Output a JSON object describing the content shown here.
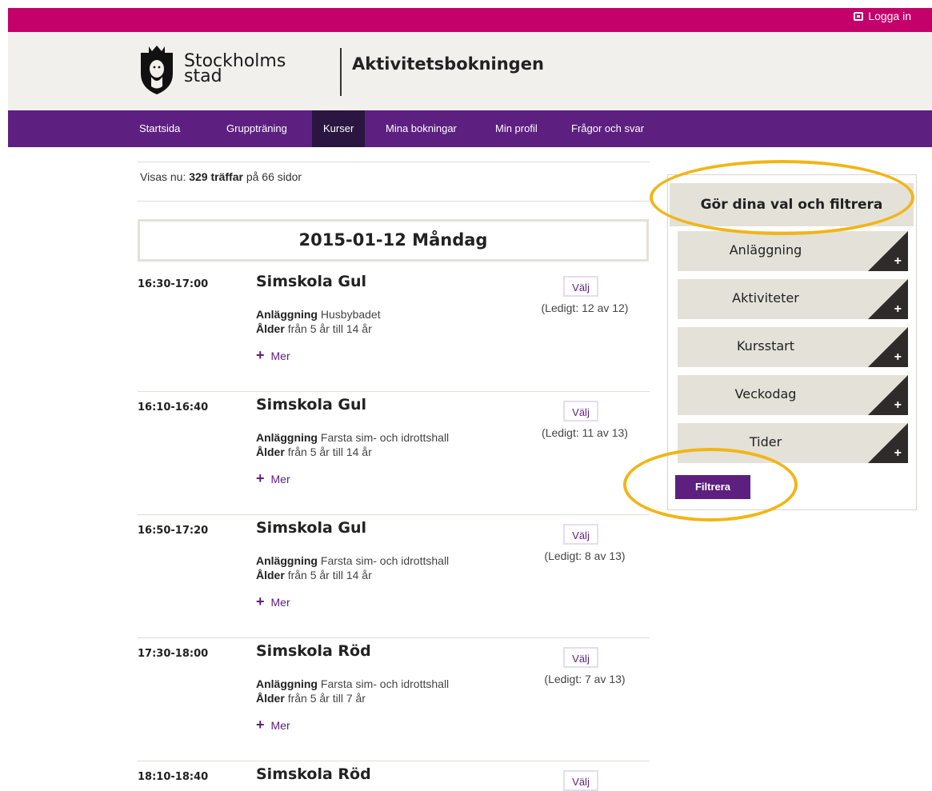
{
  "topbar": {
    "login_label": "Logga in"
  },
  "header": {
    "logo_line1": "Stockholms",
    "logo_line2": "stad",
    "app_title": "Aktivitetsbokningen"
  },
  "nav": {
    "items": [
      {
        "label": "Startsida"
      },
      {
        "label": "Gruppträning"
      },
      {
        "label": "Kurser"
      },
      {
        "label": "Mina bokningar"
      },
      {
        "label": "Min profil"
      },
      {
        "label": "Frågor och svar"
      }
    ],
    "active": "Kurser"
  },
  "results": {
    "prefix": "Visas nu:",
    "hits": "329 träffar",
    "suffix": "på 66 sidor"
  },
  "date_heading": "2015-01-12 Måndag",
  "labels": {
    "facility": "Anläggning",
    "age": "Ålder",
    "more": "Mer",
    "select": "Välj"
  },
  "courses": [
    {
      "time": "16:30-17:00",
      "title": "Simskola Gul",
      "facility": "Husbybadet",
      "age": "från 5 år till 14 år",
      "availability": "(Ledigt: 12 av 12)"
    },
    {
      "time": "16:10-16:40",
      "title": "Simskola Gul",
      "facility": "Farsta sim- och idrottshall",
      "age": "från 5 år till 14 år",
      "availability": "(Ledigt: 11 av 13)"
    },
    {
      "time": "16:50-17:20",
      "title": "Simskola Gul",
      "facility": "Farsta sim- och idrottshall",
      "age": "från 5 år till 14 år",
      "availability": "(Ledigt: 8 av 13)"
    },
    {
      "time": "17:30-18:00",
      "title": "Simskola Röd",
      "facility": "Farsta sim- och idrottshall",
      "age": "från 5 år till 7 år",
      "availability": "(Ledigt: 7 av 13)"
    },
    {
      "time": "18:10-18:40",
      "title": "Simskola Röd",
      "facility": "",
      "age": "",
      "availability": ""
    }
  ],
  "filter": {
    "heading": "Gör dina val och filtrera",
    "options": [
      {
        "label": "Anläggning"
      },
      {
        "label": "Aktiviteter"
      },
      {
        "label": "Kursstart"
      },
      {
        "label": "Veckodag"
      },
      {
        "label": "Tider"
      }
    ],
    "submit_label": "Filtrera"
  },
  "colors": {
    "topbar": "#c4006a",
    "nav": "#5d2080",
    "nav_active": "#2a1640",
    "highlight": "#f2b515",
    "panel": "#e4e1d9"
  }
}
